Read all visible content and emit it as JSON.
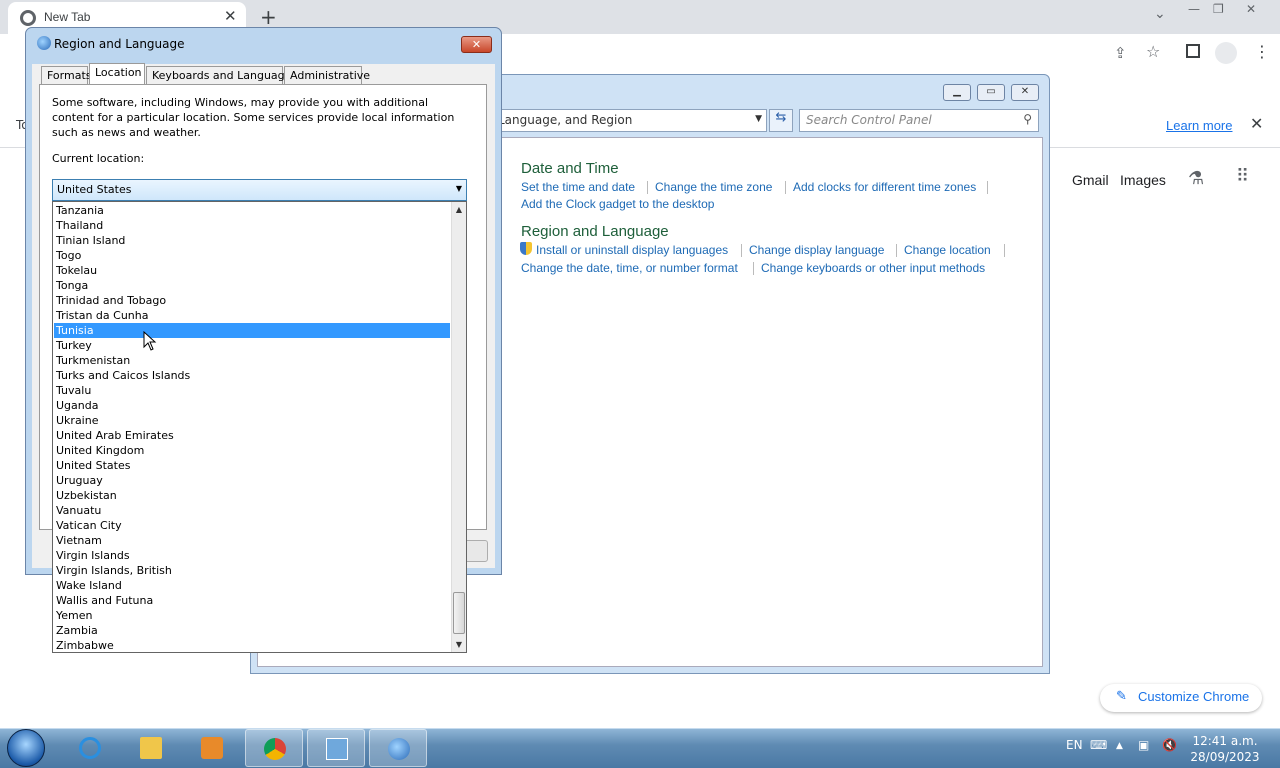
{
  "browser": {
    "tab_title": "New Tab",
    "infobar_link": "Learn more",
    "links": [
      "Gmail",
      "Images"
    ],
    "customize_label": "Customize Chrome",
    "infobar_text": "To"
  },
  "control_panel": {
    "address": "Language, and Region",
    "search_placeholder": "Search Control Panel",
    "sections": [
      {
        "heading": "Date and Time",
        "links": [
          "Set the time and date",
          "Change the time zone",
          "Add clocks for different time zones",
          "Add the Clock gadget to the desktop"
        ]
      },
      {
        "heading": "Region and Language",
        "links": [
          "Install or uninstall display languages",
          "Change display language",
          "Change location",
          "Change the date, time, or number format",
          "Change keyboards or other input methods"
        ]
      }
    ]
  },
  "dialog": {
    "title": "Region and Language",
    "tabs": [
      "Formats",
      "Location",
      "Keyboards and Languages",
      "Administrative"
    ],
    "active_tab": "Location",
    "description": "Some software, including Windows, may provide you with additional content for a particular location. Some services provide local information such as news and weather.",
    "current_location_label": "Current location:",
    "current_location_value": "United States",
    "dropdown_items": [
      "Tanzania",
      "Thailand",
      "Tinian Island",
      "Togo",
      "Tokelau",
      "Tonga",
      "Trinidad and Tobago",
      "Tristan da Cunha",
      "Tunisia",
      "Turkey",
      "Turkmenistan",
      "Turks and Caicos Islands",
      "Tuvalu",
      "Uganda",
      "Ukraine",
      "United Arab Emirates",
      "United Kingdom",
      "United States",
      "Uruguay",
      "Uzbekistan",
      "Vanuatu",
      "Vatican City",
      "Vietnam",
      "Virgin Islands",
      "Virgin Islands, British",
      "Wake Island",
      "Wallis and Futuna",
      "Yemen",
      "Zambia",
      "Zimbabwe"
    ],
    "highlighted_item": "Tunisia"
  },
  "taskbar": {
    "language": "EN",
    "time": "12:41 a.m.",
    "date": "28/09/2023"
  }
}
